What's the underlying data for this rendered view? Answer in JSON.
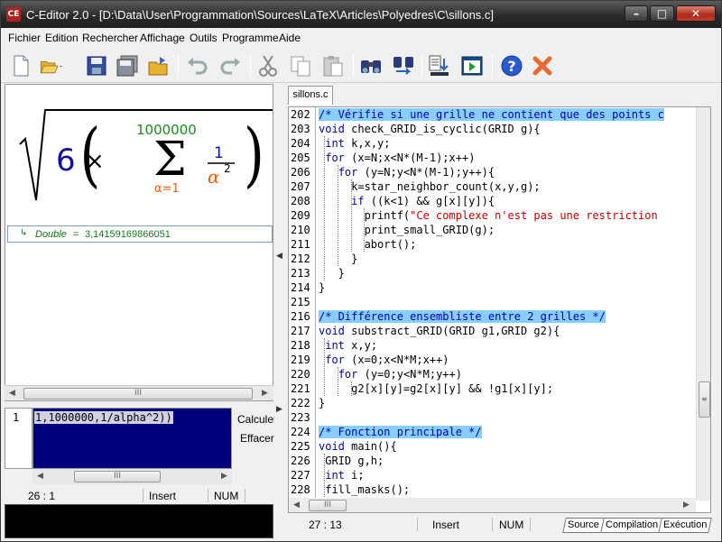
{
  "window": {
    "title": "C-Editor 2.0 - [D:\\Data\\User\\Programmation\\Sources\\LaTeX\\Articles\\Polyedres\\C\\sillons.c]",
    "app_icon_text": "CE"
  },
  "menu": [
    "Fichier",
    "Edition",
    "Rechercher",
    "Affichage",
    "Outils",
    "Programme",
    "Aide"
  ],
  "toolbar": {
    "buttons": [
      "new-file-icon",
      "open-folder-icon",
      "save-icon",
      "save-all-icon",
      "open-recent-icon",
      "undo-icon",
      "redo-icon",
      "cut-icon",
      "copy-icon",
      "paste-icon",
      "find-icon",
      "find-replace-icon",
      "compile-icon",
      "run-icon",
      "help-icon",
      "close-x-icon"
    ]
  },
  "formula": {
    "coefficient": "6",
    "times": "×",
    "sum_upper": "1000000",
    "sum_lower": "α=1",
    "frac_num": "1",
    "frac_den_base": "α",
    "frac_den_exp": "2"
  },
  "result": {
    "type": "Double",
    "equals": " = ",
    "value": "3,14159169866051"
  },
  "expression": {
    "line_no": "1",
    "text": "1,1000000,1/alpha^2))"
  },
  "side_buttons": {
    "calc": "Calculer",
    "clear": "Effacer"
  },
  "left_status": {
    "pos": "26 : 1",
    "mode": "Insert",
    "num": "NUM"
  },
  "editor": {
    "tab": "sillons.c",
    "lines": [
      {
        "n": "202",
        "t": [
          [
            "cmt",
            "/* Vérifie si une grille ne contient que des points c"
          ]
        ]
      },
      {
        "n": "203",
        "t": [
          [
            "kw",
            "void"
          ],
          [
            "",
            " check_GRID_is_cyclic(GRID g){"
          ]
        ]
      },
      {
        "n": "204",
        "t": [
          [
            "",
            " "
          ],
          [
            "kw",
            "int"
          ],
          [
            "",
            " k,x,y;"
          ]
        ]
      },
      {
        "n": "205",
        "t": [
          [
            "",
            " "
          ],
          [
            "kw",
            "for"
          ],
          [
            "",
            " (x=N;x<N*(M-1);x++)"
          ]
        ]
      },
      {
        "n": "206",
        "t": [
          [
            "",
            "   "
          ],
          [
            "kw",
            "for"
          ],
          [
            "",
            " (y=N;y<N*(M-1);y++){"
          ]
        ]
      },
      {
        "n": "207",
        "t": [
          [
            "",
            "     k=star_neighbor_count(x,y,g);"
          ]
        ]
      },
      {
        "n": "208",
        "t": [
          [
            "",
            "     "
          ],
          [
            "kw",
            "if"
          ],
          [
            "",
            " ((k<1) && g[x][y]){"
          ]
        ]
      },
      {
        "n": "209",
        "t": [
          [
            "",
            "       printf("
          ],
          [
            "str",
            "\"Ce complexe n'est pas une restriction"
          ]
        ]
      },
      {
        "n": "210",
        "t": [
          [
            "",
            "       print_small_GRID(g);"
          ]
        ]
      },
      {
        "n": "211",
        "t": [
          [
            "",
            "       abort();"
          ]
        ]
      },
      {
        "n": "212",
        "t": [
          [
            "",
            "     }"
          ]
        ]
      },
      {
        "n": "213",
        "t": [
          [
            "",
            "   }"
          ]
        ]
      },
      {
        "n": "214",
        "t": [
          [
            "",
            "}"
          ]
        ]
      },
      {
        "n": "215",
        "t": [
          [
            "",
            ""
          ]
        ]
      },
      {
        "n": "216",
        "t": [
          [
            "cmt",
            "/* Différence ensembliste entre 2 grilles */"
          ]
        ]
      },
      {
        "n": "217",
        "t": [
          [
            "kw",
            "void"
          ],
          [
            "",
            " substract_GRID(GRID g1,GRID g2){"
          ]
        ]
      },
      {
        "n": "218",
        "t": [
          [
            "",
            " "
          ],
          [
            "kw",
            "int"
          ],
          [
            "",
            " x,y;"
          ]
        ]
      },
      {
        "n": "219",
        "t": [
          [
            "",
            " "
          ],
          [
            "kw",
            "for"
          ],
          [
            "",
            " (x=0;x<N*M;x++)"
          ]
        ]
      },
      {
        "n": "220",
        "t": [
          [
            "",
            "   "
          ],
          [
            "kw",
            "for"
          ],
          [
            "",
            " (y=0;y<N*M;y++)"
          ]
        ]
      },
      {
        "n": "221",
        "t": [
          [
            "",
            "     g2[x][y]=g2[x][y] && !g1[x][y];"
          ]
        ]
      },
      {
        "n": "222",
        "t": [
          [
            "",
            "}"
          ]
        ]
      },
      {
        "n": "223",
        "t": [
          [
            "",
            ""
          ]
        ]
      },
      {
        "n": "224",
        "t": [
          [
            "cmt",
            "/* Fonction principale */"
          ]
        ]
      },
      {
        "n": "225",
        "t": [
          [
            "kw",
            "void"
          ],
          [
            "",
            " main(){"
          ]
        ]
      },
      {
        "n": "226",
        "t": [
          [
            "",
            " GRID g,h;"
          ]
        ]
      },
      {
        "n": "227",
        "t": [
          [
            "",
            " "
          ],
          [
            "kw",
            "int"
          ],
          [
            "",
            " i;"
          ]
        ]
      },
      {
        "n": "228",
        "t": [
          [
            "",
            " fill_masks();"
          ]
        ]
      }
    ]
  },
  "editor_status": {
    "pos": "27 : 13",
    "mode": "Insert",
    "num": "NUM"
  },
  "bottom_tabs": [
    "Source",
    "Compilation",
    "Exécution"
  ],
  "scroll_grip": "III",
  "colors": {
    "comment_bg": "#87cefa",
    "keyword": "#0000b0",
    "string": "#c00000",
    "result": "#1a7a1a",
    "expr_bg": "#00007f"
  }
}
